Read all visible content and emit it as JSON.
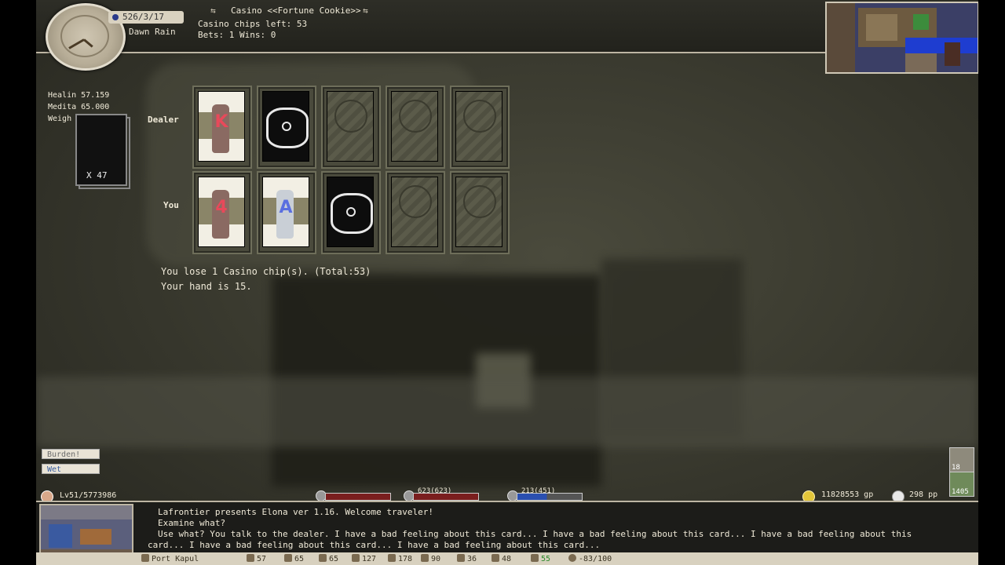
{
  "header": {
    "date": "526/3/17",
    "weather": "Dawn Rain",
    "casino_title": "Casino <<Fortune Cookie>>",
    "chips_left": "Casino chips left: 53",
    "bets_wins": "Bets: 1 Wins: 0"
  },
  "stats": {
    "healing": "Healin 57.159",
    "meditation": "Medita 65.000",
    "weight": "Weigh"
  },
  "deck": {
    "count": "X 47"
  },
  "table": {
    "dealer_label": "Dealer",
    "you_label": "You",
    "dealer_cards": [
      {
        "state": "front",
        "rank": "K",
        "rank_color": "#e8495a"
      },
      {
        "state": "back"
      },
      {
        "state": "empty"
      },
      {
        "state": "empty"
      },
      {
        "state": "empty"
      }
    ],
    "player_cards": [
      {
        "state": "front",
        "rank": "4",
        "rank_color": "#e8495a"
      },
      {
        "state": "front",
        "rank": "A",
        "rank_color": "#5a6fe0"
      },
      {
        "state": "back"
      },
      {
        "state": "empty"
      },
      {
        "state": "empty"
      }
    ],
    "messages": [
      "You lose 1 Casino chip(s). (Total:53)",
      "Your hand is 15."
    ]
  },
  "status_effects": [
    "Burden!",
    "Wet"
  ],
  "bottom": {
    "level": "Lv51/5773986",
    "hp": "",
    "mp": "623(623)",
    "sp": "213(451)",
    "gold": "11828553 gp",
    "platinum": "298 pp",
    "side_counts": [
      "18",
      "1405"
    ]
  },
  "log": [
    "Lafrontier presents Elona ver 1.16. Welcome traveler!",
    "Examine what?",
    "Use what?  You talk to the dealer. I have a bad feeling about this card... I have a bad feeling about this card... I have a bad feeling about this",
    "card... I have a bad feeling about this card... I have a bad feeling about this card..."
  ],
  "footer": {
    "location": "Port Kapul",
    "attrs": [
      "57",
      "65",
      "65",
      "127",
      "178",
      "90",
      "36",
      "48",
      "55"
    ],
    "extra": "-83/100"
  }
}
